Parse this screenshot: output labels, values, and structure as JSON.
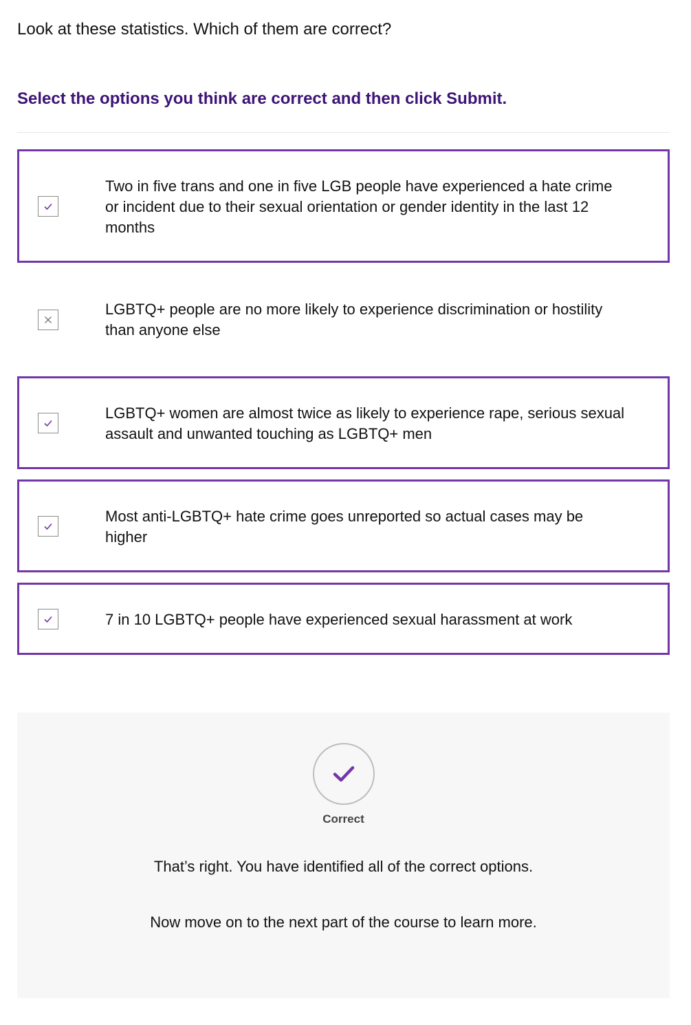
{
  "question": "Look at these statistics. Which of them are correct?",
  "instruction": "Select the options you think are correct and then click Submit.",
  "options": [
    {
      "text": "Two in five trans and one in five LGB people have experienced a hate crime or incident due to their sexual orientation or gender identity in the last 12 months",
      "selected": true,
      "mark_icon": "check-icon"
    },
    {
      "text": "LGBTQ+ people are no more likely to experience discrimination or hostility than anyone else",
      "selected": false,
      "mark_icon": "cross-icon"
    },
    {
      "text": "LGBTQ+ women are almost twice as likely to experience rape, serious sexual assault and unwanted touching as LGBTQ+ men",
      "selected": true,
      "mark_icon": "check-icon"
    },
    {
      "text": "Most anti-LGBTQ+ hate crime goes unreported so actual cases may be higher",
      "selected": true,
      "mark_icon": "check-icon"
    },
    {
      "text": "7 in 10 LGBTQ+ people have experienced sexual harassment at work",
      "selected": true,
      "mark_icon": "check-icon"
    }
  ],
  "feedback": {
    "status_icon": "check-icon",
    "status_label": "Correct",
    "message": "That’s right. You have identified all of the correct options.",
    "next_step": "Now move on to the next part of the course to learn more."
  },
  "colors": {
    "accent": "#7236a8",
    "instruction": "#3d1476",
    "feedback_bg": "#f7f7f7"
  }
}
